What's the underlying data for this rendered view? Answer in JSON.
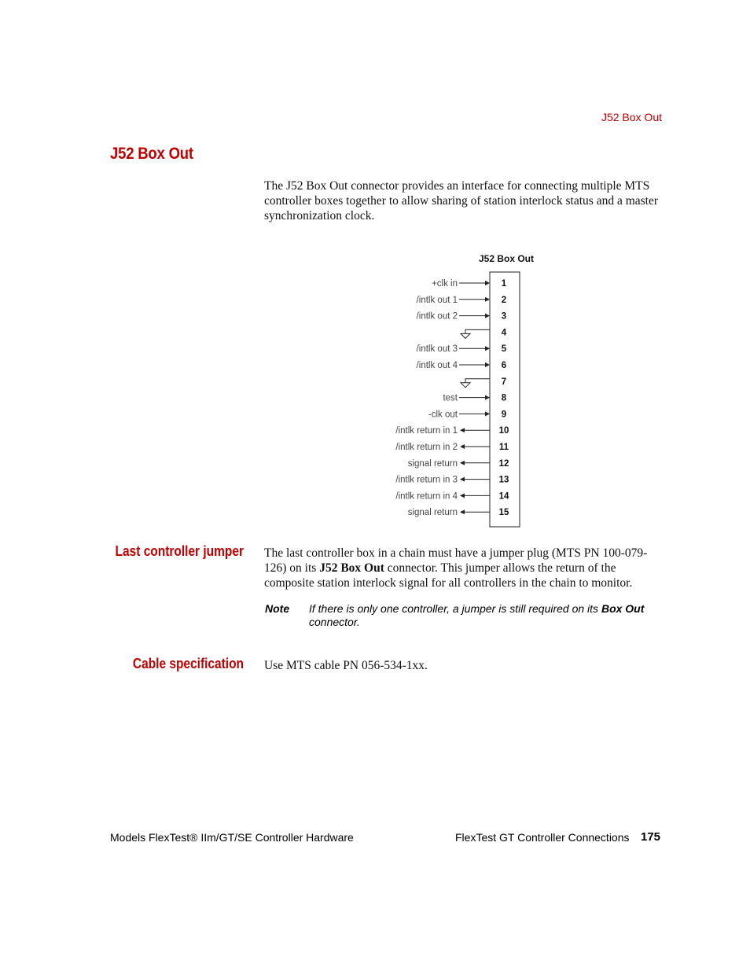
{
  "running_head": "J52 Box Out",
  "section": {
    "title": "J52 Box Out",
    "intro": "The J52 Box Out connector provides an interface for connecting multiple MTS controller boxes together to allow sharing of station interlock status and a master synchronization clock."
  },
  "diagram": {
    "title": "J52 Box Out",
    "pins": [
      {
        "pin": "1",
        "label": "+clk in",
        "direction": "in"
      },
      {
        "pin": "2",
        "label": "/intlk out 1",
        "direction": "in"
      },
      {
        "pin": "3",
        "label": "/intlk out 2",
        "direction": "in"
      },
      {
        "pin": "4",
        "label": "",
        "direction": "ground"
      },
      {
        "pin": "5",
        "label": "/intlk out 3",
        "direction": "in"
      },
      {
        "pin": "6",
        "label": "/intlk out 4",
        "direction": "in"
      },
      {
        "pin": "7",
        "label": "",
        "direction": "ground"
      },
      {
        "pin": "8",
        "label": "test",
        "direction": "in"
      },
      {
        "pin": "9",
        "label": "-clk out",
        "direction": "in"
      },
      {
        "pin": "10",
        "label": "/intlk return in 1",
        "direction": "out"
      },
      {
        "pin": "11",
        "label": "/intlk return in 2",
        "direction": "out"
      },
      {
        "pin": "12",
        "label": "signal return",
        "direction": "out"
      },
      {
        "pin": "13",
        "label": "/intlk return in 3",
        "direction": "out"
      },
      {
        "pin": "14",
        "label": "/intlk return in 4",
        "direction": "out"
      },
      {
        "pin": "15",
        "label": "signal return",
        "direction": "out"
      }
    ]
  },
  "last_controller_jumper": {
    "heading": "Last controller jumper",
    "text_before": "The last controller box in a chain must have a jumper plug (MTS PN 100-079-126) on its ",
    "text_bold": "J52 Box Out",
    "text_after": " connector. This jumper allows the return of the composite station interlock signal for all controllers in the chain to monitor.",
    "note_label": "Note",
    "note_before": "If there is only one controller, a jumper is still required on its ",
    "note_bold": "Box Out",
    "note_after": " connector."
  },
  "cable_specification": {
    "heading": "Cable specification",
    "text": "Use MTS cable PN 056-534-1xx."
  },
  "footer": {
    "left": "Models FlexTest® IIm/GT/SE Controller Hardware",
    "right": "FlexTest GT Controller Connections",
    "page_number": "175"
  }
}
